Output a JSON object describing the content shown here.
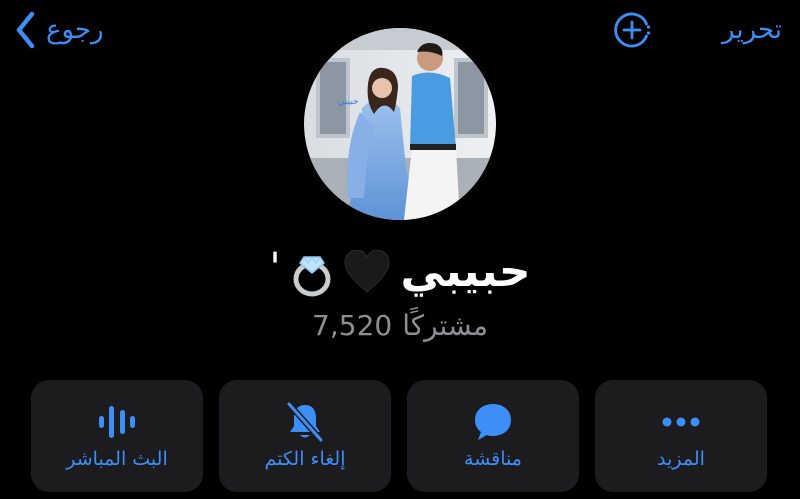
{
  "header": {
    "back_label": "رجوع",
    "edit_label": "تحرير"
  },
  "profile": {
    "name": "حبيبي",
    "name_suffix": "'",
    "subscribers_count": "7,520",
    "subscribers_label": "مشتركًا",
    "photo_caption": "حبيبي"
  },
  "actions": [
    {
      "label": "البث المباشر",
      "icon": "live-stream-icon"
    },
    {
      "label": "إلغاء الكتم",
      "icon": "bell-slash-icon"
    },
    {
      "label": "مناقشة",
      "icon": "chat-bubble-icon"
    },
    {
      "label": "المزيد",
      "icon": "more-dots-icon"
    }
  ],
  "colors": {
    "accent": "#3e8ef7",
    "background": "#000000",
    "button_bg": "#1c1c1e",
    "secondary_text": "#8e8e93"
  }
}
